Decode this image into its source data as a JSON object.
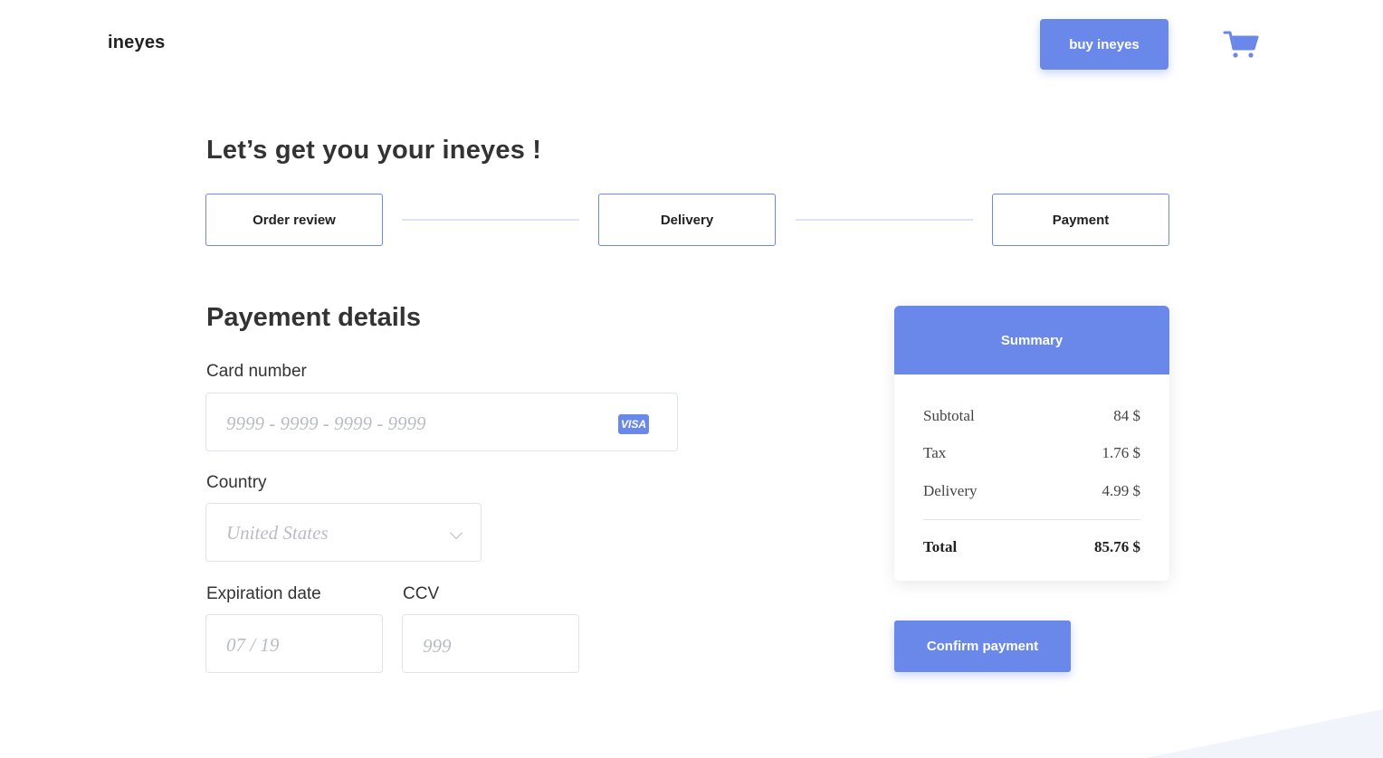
{
  "header": {
    "logo": "ineyes",
    "buy_button": "buy ineyes",
    "cart_icon": "cart-icon"
  },
  "page_title": "Let’s get you your ineyes !",
  "steps": [
    {
      "label": "Order review"
    },
    {
      "label": "Delivery"
    },
    {
      "label": "Payment"
    }
  ],
  "payment": {
    "title": "Payement details",
    "card_number": {
      "label": "Card number",
      "placeholder": "9999 - 9999 - 9999 - 9999",
      "badge": "VISA"
    },
    "country": {
      "label": "Country",
      "selected": "United States"
    },
    "expiration": {
      "label": "Expiration date",
      "placeholder": "07 / 19"
    },
    "ccv": {
      "label": "CCV",
      "placeholder": "999"
    }
  },
  "summary": {
    "title": "Summary",
    "rows": [
      {
        "label": "Subtotal",
        "value": "84 $"
      },
      {
        "label": "Tax",
        "value": "1.76 $"
      },
      {
        "label": "Delivery",
        "value": "4.99 $"
      }
    ],
    "total": {
      "label": "Total",
      "value": "85.76 $"
    }
  },
  "confirm_button": "Confirm payment",
  "colors": {
    "accent": "#6a88ea",
    "input_border": "#dfe3ec",
    "placeholder": "#b9bcc3"
  }
}
